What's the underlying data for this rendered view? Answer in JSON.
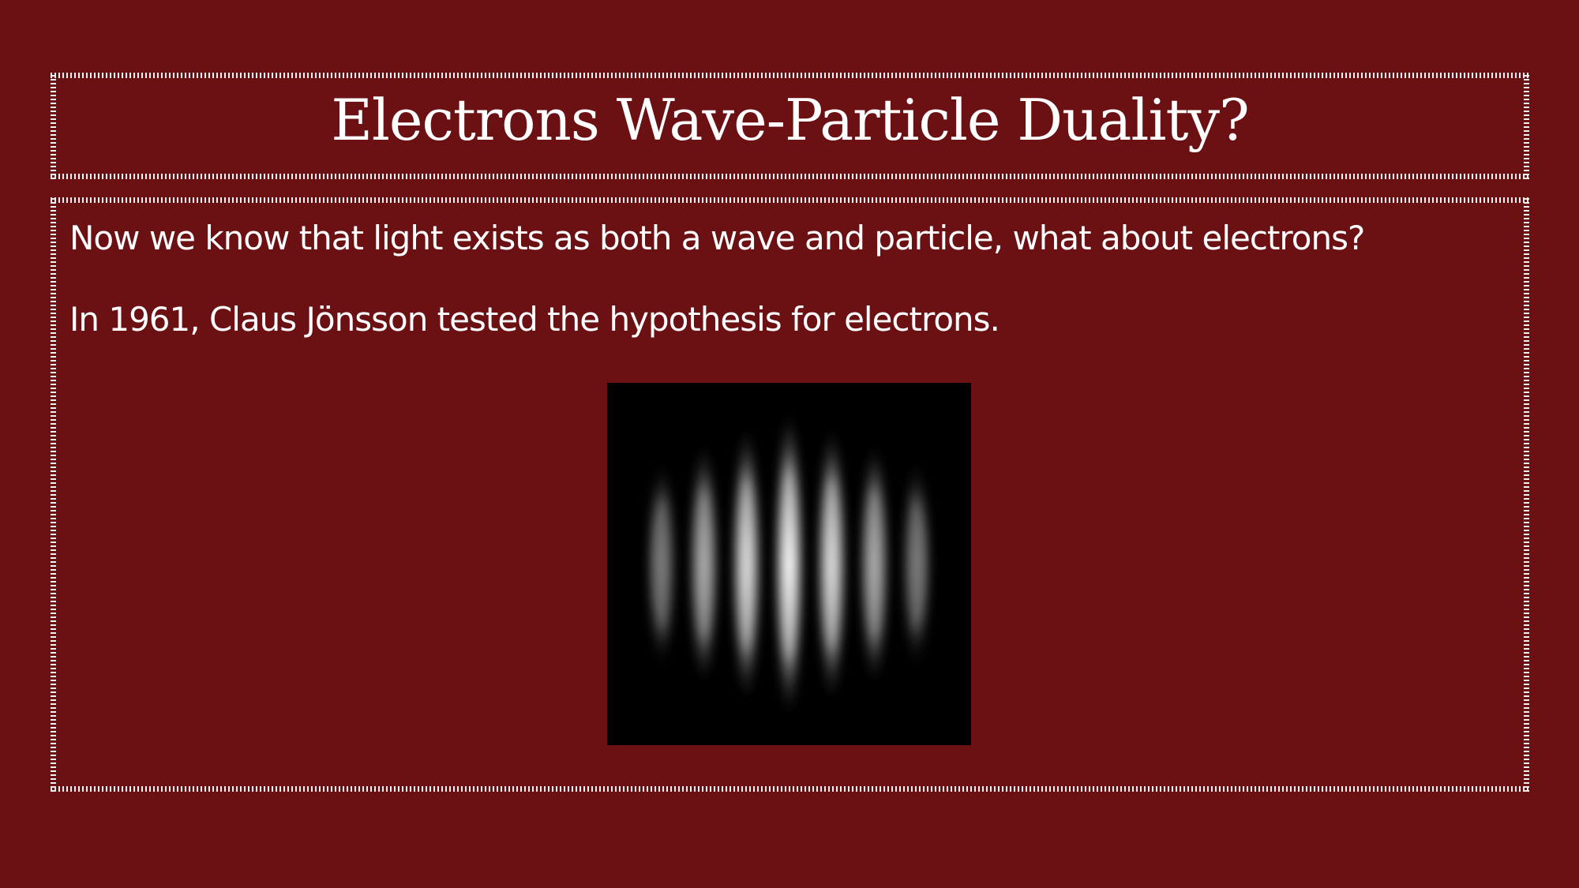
{
  "slide": {
    "title": "Electrons Wave-Particle Duality?",
    "paragraphs": [
      "Now we know that light exists as both a wave and particle, what about electrons?",
      "In 1961, Claus Jönsson tested the hypothesis for electrons."
    ]
  },
  "image": {
    "description_name": "electron-interference-fringes",
    "fringe_count": 7
  },
  "colors": {
    "background": "#6b1113",
    "text": "#ffffff",
    "frame_border": "#f2f2f2",
    "image_background": "#000000"
  }
}
